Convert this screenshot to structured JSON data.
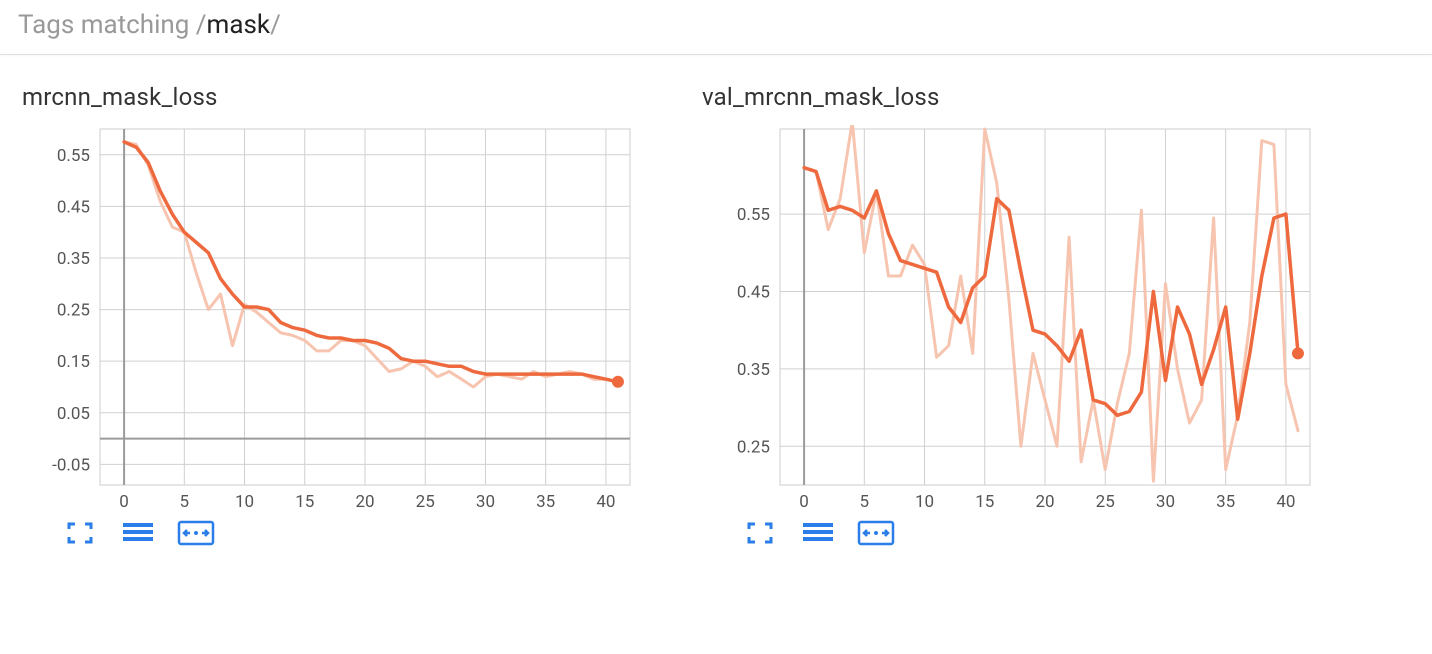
{
  "search": {
    "prefix": "Tags matching /",
    "query": "mask",
    "suffix": "/"
  },
  "colors": {
    "line": "#ee6a3e",
    "line_faint": "#f7c4b0",
    "accent": "#2b7de9"
  },
  "toolbar": {
    "expand": "expand",
    "lines": "toggle-lines",
    "fit": "fit-domain"
  },
  "panels": [
    {
      "title": "mrcnn_mask_loss",
      "chart_key": 0
    },
    {
      "title": "val_mrcnn_mask_loss",
      "chart_key": 1
    }
  ],
  "chart_data": [
    {
      "type": "line",
      "title": "mrcnn_mask_loss",
      "xlabel": "",
      "ylabel": "",
      "xlim": [
        -2,
        42
      ],
      "ylim": [
        -0.09,
        0.6
      ],
      "xticks": [
        0,
        5,
        10,
        15,
        20,
        25,
        30,
        35,
        40
      ],
      "yticks": [
        -0.05,
        0.05,
        0.15,
        0.25,
        0.35,
        0.45,
        0.55
      ],
      "x": [
        0,
        1,
        2,
        3,
        4,
        5,
        6,
        7,
        8,
        9,
        10,
        11,
        12,
        13,
        14,
        15,
        16,
        17,
        18,
        19,
        20,
        21,
        22,
        23,
        24,
        25,
        26,
        27,
        28,
        29,
        30,
        31,
        32,
        33,
        34,
        35,
        36,
        37,
        38,
        39,
        40,
        41
      ],
      "series": [
        {
          "name": "raw",
          "values": [
            0.575,
            0.57,
            0.53,
            0.46,
            0.41,
            0.4,
            0.32,
            0.25,
            0.28,
            0.18,
            0.26,
            0.245,
            0.225,
            0.205,
            0.2,
            0.19,
            0.17,
            0.17,
            0.19,
            0.19,
            0.18,
            0.155,
            0.13,
            0.135,
            0.15,
            0.14,
            0.12,
            0.13,
            0.115,
            0.1,
            0.12,
            0.125,
            0.12,
            0.115,
            0.13,
            0.12,
            0.125,
            0.13,
            0.125,
            0.115,
            0.115,
            0.11
          ]
        },
        {
          "name": "smoothed",
          "values": [
            0.575,
            0.565,
            0.535,
            0.48,
            0.435,
            0.4,
            0.38,
            0.36,
            0.31,
            0.28,
            0.255,
            0.255,
            0.25,
            0.225,
            0.215,
            0.21,
            0.2,
            0.195,
            0.195,
            0.19,
            0.19,
            0.185,
            0.175,
            0.155,
            0.15,
            0.15,
            0.145,
            0.14,
            0.14,
            0.13,
            0.125,
            0.125,
            0.125,
            0.125,
            0.125,
            0.125,
            0.125,
            0.125,
            0.125,
            0.12,
            0.115,
            0.11
          ]
        }
      ]
    },
    {
      "type": "line",
      "title": "val_mrcnn_mask_loss",
      "xlabel": "",
      "ylabel": "",
      "xlim": [
        -2,
        42
      ],
      "ylim": [
        0.2,
        0.66
      ],
      "xticks": [
        0,
        5,
        10,
        15,
        20,
        25,
        30,
        35,
        40
      ],
      "yticks": [
        0.25,
        0.35,
        0.45,
        0.55
      ],
      "x": [
        0,
        1,
        2,
        3,
        4,
        5,
        6,
        7,
        8,
        9,
        10,
        11,
        12,
        13,
        14,
        15,
        16,
        17,
        18,
        19,
        20,
        21,
        22,
        23,
        24,
        25,
        26,
        27,
        28,
        29,
        30,
        31,
        32,
        33,
        34,
        35,
        36,
        37,
        38,
        39,
        40,
        41
      ],
      "series": [
        {
          "name": "raw",
          "values": [
            0.61,
            0.605,
            0.53,
            0.57,
            0.67,
            0.5,
            0.58,
            0.47,
            0.47,
            0.51,
            0.485,
            0.365,
            0.38,
            0.47,
            0.37,
            0.66,
            0.59,
            0.44,
            0.25,
            0.37,
            0.31,
            0.25,
            0.52,
            0.23,
            0.31,
            0.22,
            0.305,
            0.37,
            0.555,
            0.205,
            0.46,
            0.35,
            0.28,
            0.31,
            0.545,
            0.22,
            0.29,
            0.41,
            0.645,
            0.64,
            0.33,
            0.27
          ]
        },
        {
          "name": "smoothed",
          "values": [
            0.61,
            0.605,
            0.555,
            0.56,
            0.555,
            0.545,
            0.58,
            0.525,
            0.49,
            0.485,
            0.48,
            0.475,
            0.43,
            0.41,
            0.455,
            0.47,
            0.57,
            0.555,
            0.475,
            0.4,
            0.395,
            0.38,
            0.36,
            0.4,
            0.31,
            0.305,
            0.29,
            0.295,
            0.32,
            0.45,
            0.335,
            0.43,
            0.395,
            0.33,
            0.375,
            0.43,
            0.285,
            0.37,
            0.47,
            0.545,
            0.55,
            0.37
          ]
        }
      ]
    }
  ]
}
